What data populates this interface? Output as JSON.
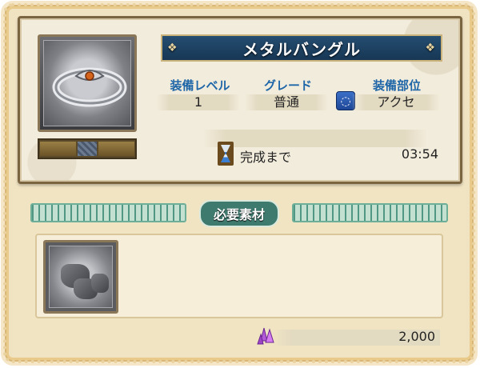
{
  "item": {
    "name": "メタルバングル",
    "icon": "metal-bangle-icon"
  },
  "stats": {
    "level_label": "装備レベル",
    "level_value": "1",
    "grade_label": "グレード",
    "grade_value": "普通",
    "slot_label": "装備部位",
    "slot_value": "アクセ",
    "slot_icon": "ring-icon"
  },
  "timer": {
    "label": "完成まで",
    "value": "03:54",
    "icon": "hourglass-icon"
  },
  "materials": {
    "title": "必要素材",
    "items": [
      {
        "icon": "ore-icon"
      }
    ]
  },
  "cost": {
    "value": "2,000",
    "icon": "crystal-icon"
  },
  "colors": {
    "title_banner": "#1f4366",
    "stat_label": "#1f66a8",
    "section_title": "#3f7a6f"
  }
}
